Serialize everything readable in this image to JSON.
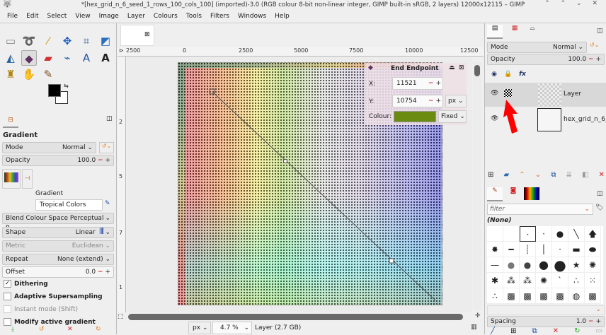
{
  "window": {
    "title": "*[hex_grid_n_6_seed_1_rows_100_cols_100] (imported)-3.0 (RGB colour 8-bit non-linear integer, GIMP built-in sRGB, 2 layers) 12000x12115 – GIMP",
    "controls": "⌃ ⌃ ⌄ ✕"
  },
  "menu": [
    "File",
    "Edit",
    "Select",
    "View",
    "Image",
    "Layer",
    "Colours",
    "Tools",
    "Filters",
    "Windows",
    "Help"
  ],
  "tool_options": {
    "title": "Gradient",
    "mode_label": "Mode",
    "mode_value": "Normal",
    "opacity_label": "Opacity",
    "opacity_value": "100.0",
    "gradient_label": "Gradient",
    "gradient_value": "Tropical Colors",
    "blend_label": "Blend Colour Space",
    "blend_value": "Perceptual R...",
    "shape_label": "Shape",
    "shape_value": "Linear",
    "metric_label": "Metric",
    "metric_value": "Euclidean",
    "repeat_label": "Repeat",
    "repeat_value": "None (extend)",
    "offset_label": "Offset",
    "offset_value": "0.0",
    "dithering": "Dithering",
    "adaptive": "Adaptive Supersampling",
    "instant": "Instant mode  (Shift)",
    "modify": "Modify active gradient"
  },
  "ruler": {
    "h": [
      "2500",
      "0",
      "2500",
      "5000",
      "7500",
      "10000",
      "12500"
    ],
    "v": [
      "2",
      "5",
      "7",
      "1"
    ]
  },
  "endpoint": {
    "title": "End Endpoint",
    "x_label": "X:",
    "x_value": "11521",
    "y_label": "Y:",
    "y_value": "10754",
    "unit": "px",
    "colour_label": "Colour:",
    "colour_mode": "Fixed",
    "colour": "#6a8a10"
  },
  "status": {
    "unit": "px",
    "zoom": "4.7 %",
    "info": "Layer (2.7 GB)"
  },
  "layers": {
    "mode_label": "Mode",
    "mode_value": "Normal",
    "opacity_label": "Opacity",
    "opacity_value": "100.0",
    "items": [
      {
        "name": "Layer"
      },
      {
        "name": "hex_grid_n_6_"
      }
    ]
  },
  "brushes": {
    "filter_placeholder": "filter",
    "selected": "(None)",
    "spacing_label": "Spacing",
    "spacing_value": "1.0"
  }
}
